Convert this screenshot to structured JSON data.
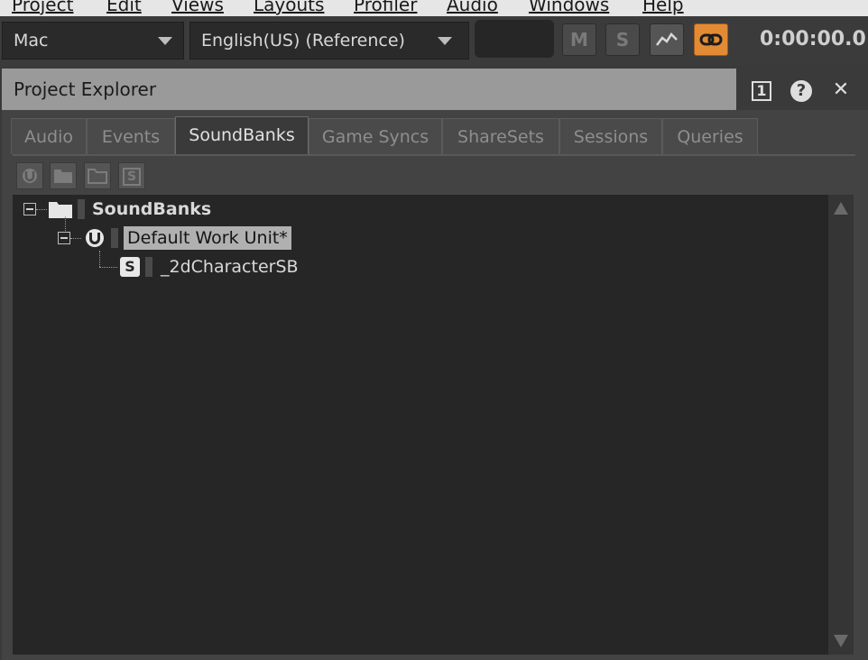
{
  "menu": [
    "Project",
    "Edit",
    "Views",
    "Layouts",
    "Profiler",
    "Audio",
    "Windows",
    "Help"
  ],
  "toolbar": {
    "platform": "Mac",
    "language": "English(US) (Reference)",
    "mute_label": "M",
    "solo_label": "S",
    "timecode": "0:00:00.0",
    "accent_color": "#e38b34"
  },
  "panel": {
    "title": "Project Explorer",
    "layout_button": "1",
    "help_icon": "?",
    "close_icon": "✕"
  },
  "tabs": [
    {
      "label": "Audio",
      "selected": false
    },
    {
      "label": "Events",
      "selected": false
    },
    {
      "label": "SoundBanks",
      "selected": true
    },
    {
      "label": "Game Syncs",
      "selected": false
    },
    {
      "label": "ShareSets",
      "selected": false
    },
    {
      "label": "Sessions",
      "selected": false
    },
    {
      "label": "Queries",
      "selected": false
    }
  ],
  "subtoolbar": {
    "new_soundbank_glyph": "S"
  },
  "tree": {
    "root": {
      "label": "SoundBanks",
      "icon": "folder-icon"
    },
    "work_unit": {
      "label": "Default Work Unit*",
      "icon": "work-unit-icon",
      "selected": true
    },
    "soundbank": {
      "label": "_2dCharacterSB",
      "icon_glyph": "S"
    }
  }
}
